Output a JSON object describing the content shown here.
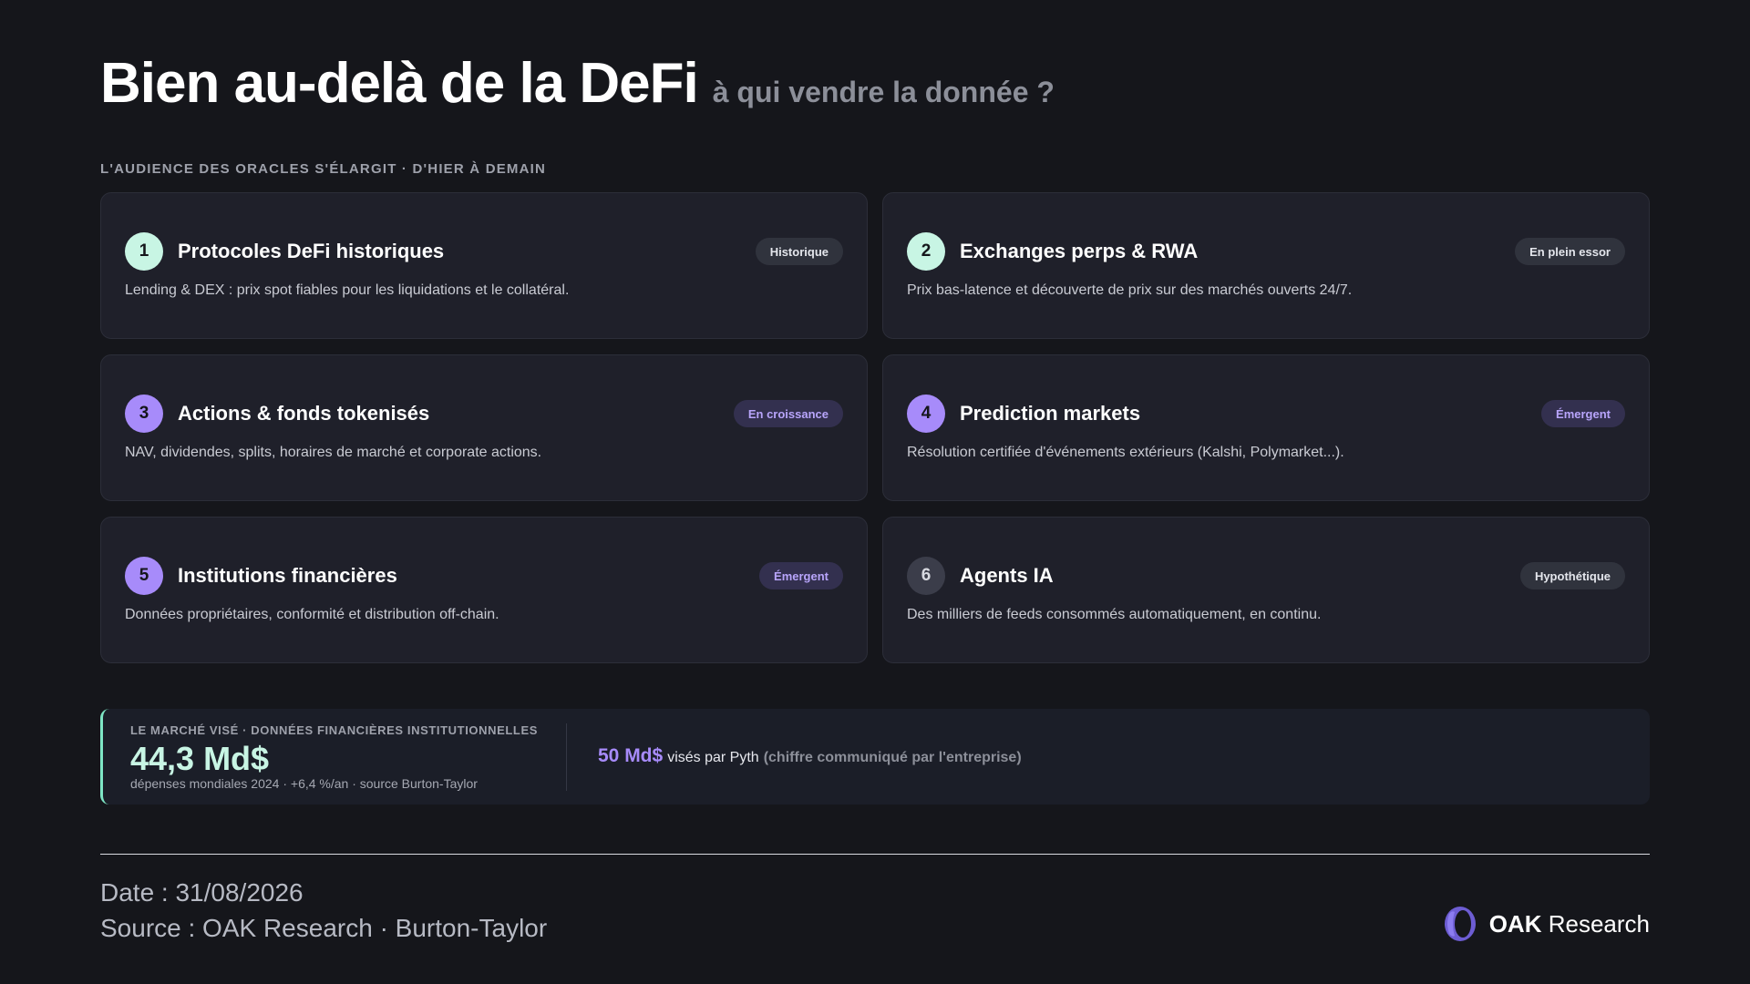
{
  "header": {
    "title": "Bien au-delà de la DeFi",
    "subtitle": "à qui vendre la donnée ?"
  },
  "section_label": "L'AUDIENCE DES ORACLES S'ÉLARGIT · D'HIER À DEMAIN",
  "cards": [
    {
      "number": "1",
      "title": "Protocoles DeFi historiques",
      "badge": "Historique",
      "description": "Lending & DEX : prix spot fiables pour les liquidations et le collatéral."
    },
    {
      "number": "2",
      "title": "Exchanges perps & RWA",
      "badge": "En plein essor",
      "description": "Prix bas-latence et découverte de prix sur des marchés ouverts 24/7."
    },
    {
      "number": "3",
      "title": "Actions & fonds tokenisés",
      "badge": "En croissance",
      "description": "NAV, dividendes, splits, horaires de marché et corporate actions."
    },
    {
      "number": "4",
      "title": "Prediction markets",
      "badge": "Émergent",
      "description": "Résolution certifiée d'événements extérieurs (Kalshi, Polymarket...)."
    },
    {
      "number": "5",
      "title": "Institutions financières",
      "badge": "Émergent",
      "description": "Données propriétaires, conformité et distribution off-chain."
    },
    {
      "number": "6",
      "title": "Agents IA",
      "badge": "Hypothétique",
      "description": "Des milliers de feeds consommés automatiquement, en continu."
    }
  ],
  "market": {
    "label": "LE MARCHÉ VISÉ · DONNÉES FINANCIÈRES INSTITUTIONNELLES",
    "value": "44,3 Md$",
    "subtext": "dépenses mondiales 2024 · +6,4 %/an · source Burton-Taylor",
    "pyth_value": "50 Md$",
    "pyth_text": "visés par Pyth",
    "pyth_note": "(chiffre communiqué par l'entreprise)"
  },
  "footer": {
    "date": "Date : 31/08/2026",
    "source": "Source : OAK Research · Burton-Taylor",
    "brand_bold": "OAK",
    "brand_rest": "Research"
  },
  "colors": {
    "background": "#15161b",
    "card": "#1f202a",
    "mint": "#c8f5e4",
    "violet": "#a78bfa",
    "accent_border": "#7ee6c5"
  }
}
